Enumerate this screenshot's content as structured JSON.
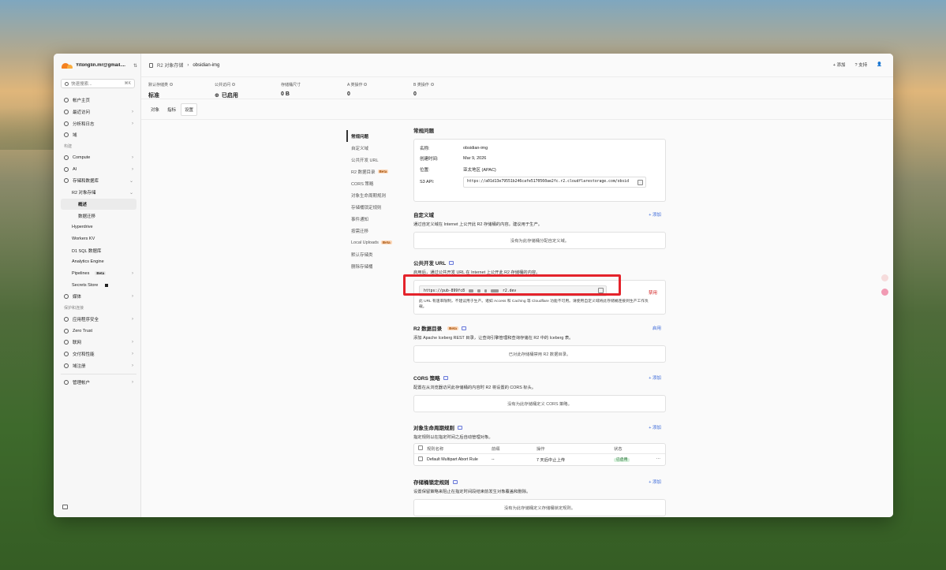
{
  "account": {
    "name": "Yitonglin.mr@gmail...."
  },
  "search": {
    "placeholder": "快速搜索...",
    "shortcut": "⌘K"
  },
  "sidebar": {
    "items": [
      {
        "label": "帐户主页",
        "icon": "home-icon"
      },
      {
        "label": "最近访问",
        "icon": "clock-icon",
        "chev": "›"
      },
      {
        "label": "分析和日志",
        "icon": "chart-icon",
        "chev": "›"
      },
      {
        "label": "域",
        "icon": "globe-icon"
      }
    ],
    "section_build": "构建",
    "build_items": [
      {
        "label": "Compute",
        "icon": "compute-icon",
        "chev": "›"
      },
      {
        "label": "AI",
        "icon": "ai-icon",
        "chev": "›"
      },
      {
        "label": "存储和数据库",
        "icon": "database-icon",
        "chev": "⌄"
      }
    ],
    "r2": {
      "label": "R2 对象存储",
      "chev": "⌄"
    },
    "r2_children": [
      "概述",
      "数据迁移"
    ],
    "storage_children": [
      "Hyperdrive",
      "Workers KV",
      "D1 SQL 数据库",
      "Analytics Engine"
    ],
    "pipelines": {
      "label": "Pipelines",
      "beta": "Beta",
      "chev": "›"
    },
    "secrets": {
      "label": "Secrets Store"
    },
    "media": {
      "label": "媒体",
      "chev": "›"
    },
    "section_protect": "保护和连接",
    "protect_items": [
      {
        "label": "应用程序安全",
        "chev": "›"
      },
      {
        "label": "Zero Trust",
        "chev": ""
      },
      {
        "label": "联网",
        "chev": "›"
      },
      {
        "label": "交付和性能",
        "chev": "›"
      },
      {
        "label": "域注册",
        "chev": "›"
      }
    ],
    "manage": {
      "label": "管理帐户",
      "chev": "›"
    }
  },
  "topbar": {
    "crumb_root": "R2 对象存储",
    "crumb_sep": "›",
    "crumb_current": "obsidian-img",
    "add": "+ 添加",
    "support": "支持",
    "user_icon": "user-icon"
  },
  "stats": [
    {
      "label": "默认存储类",
      "value": "标准"
    },
    {
      "label": "公共访问",
      "value": "已启用"
    },
    {
      "label": "存储桶尺寸",
      "value": "0 B"
    },
    {
      "label": "A 类操作",
      "value": "0"
    },
    {
      "label": "B 类操作",
      "value": "0"
    }
  ],
  "tabs": [
    "对象",
    "指标",
    "设置"
  ],
  "toc": [
    "常规问题",
    "自定义域",
    "公共开发 URL",
    "R2 数据目录",
    "CORS 策略",
    "对象生命周期规则",
    "存储桶锁定规则",
    "事件通知",
    "按需迁移",
    "Local Uploads",
    "默认存储类",
    "删除存储桶"
  ],
  "toc_beta": "Beta",
  "general": {
    "title": "常规问题",
    "rows": [
      {
        "k": "名称:",
        "v": "obsidian-img"
      },
      {
        "k": "创建时间:",
        "v": "Mar 9, 2026"
      },
      {
        "k": "位置:",
        "v": "亚太地区 (APAC)"
      }
    ],
    "s3_label": "S3 API:",
    "s3_value": "https://a01d13e79551b246cafe5170560ae2fc.r2.cloudflarestorage.com/obsid"
  },
  "custom_domain": {
    "title": "自定义域",
    "desc": "通过自定义域在 Internet 上公开此 R2 存储桶的内容。建议用于生产。",
    "add": "+ 添加",
    "empty": "没有为此存储桶分配自定义域。"
  },
  "dev_url": {
    "title": "公共开发 URL",
    "desc": "启用后，通过公共开发 URL 在 Internet 上公开此 R2 存储桶的内容。",
    "url_start": "https://pub-899fc8",
    "url_end": "r2.dev",
    "disable": "禁用",
    "note": "此 URL 有速率限制，不建议用于生产。诸如 Access 和 Caching 等 Cloudflare 功能不可用。请使用自定义域将此存储桶连接到生产工作负载。"
  },
  "catalog": {
    "title": "R2 数据目录",
    "beta": "Beta",
    "desc": "添加 Apache Iceberg REST 目录，让查询引擎管理和查询存储在 R2 中的 Iceberg 表。",
    "enable": "启用",
    "empty": "已对此存储桶禁用 R2 数据目录。"
  },
  "cors": {
    "title": "CORS 策略",
    "desc": "配置在从浏览器访问此存储桶的内容时 R2 将设置的 CORS 标头。",
    "add": "+ 添加",
    "empty": "没有为此存储桶定义 CORS 策略。"
  },
  "lifecycle": {
    "title": "对象生命周期规则",
    "desc": "指定规则以在指定时间之后自动管理对象。",
    "add": "+ 添加",
    "headers": [
      "规则名称",
      "前缀",
      "操作",
      "状态"
    ],
    "rows": [
      {
        "name": "Default Multipart Abort Rule",
        "prefix": "--",
        "action": "7 天后中止上传",
        "status": "已启用",
        "more": "···"
      }
    ]
  },
  "lock": {
    "title": "存储桶锁定规则",
    "desc": "设置保留策略来阻止在指定时间段结束前发生对象覆盖和删除。",
    "add": "+ 添加",
    "empty": "没有为此存储桶定义存储桶锁定规则。"
  },
  "colors": {
    "accent": "#3565d8",
    "danger": "#d32020",
    "highlight": "#e4232b",
    "brand": "#f48120"
  }
}
